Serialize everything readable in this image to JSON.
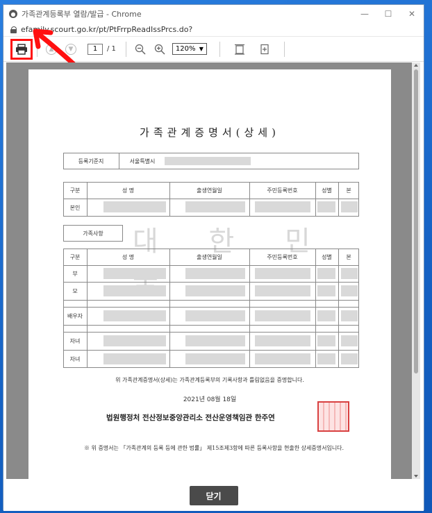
{
  "window": {
    "title": "가족관계등록부 열람/발급 - Chrome",
    "url": "efamily.scourt.go.kr/pt/PtFrrpReadIssPrcs.do?",
    "minimize": "—",
    "maximize": "☐",
    "close": "✕"
  },
  "toolbar": {
    "page_current": "1",
    "page_total": "/ 1",
    "zoom": "120%"
  },
  "document": {
    "title": "가족관계증명서(상세)",
    "reg_label": "등록기준지",
    "reg_value": "서울특별시",
    "table1_headers": [
      "구분",
      "성   명",
      "출생연월일",
      "주민등록번호",
      "성별",
      "본"
    ],
    "table1_rows": [
      "본인"
    ],
    "family_label": "가족사항",
    "table2_headers": [
      "구분",
      "성   명",
      "출생연월일",
      "주민등록번호",
      "성별",
      "본"
    ],
    "table2_rows": [
      "부",
      "모",
      "배우자",
      "자녀",
      "자녀"
    ],
    "statement": "위 가족관계증명서(상세)는 가족관계등록부의 기록사항과 틀림없음을 증명합니다.",
    "date": "2021년 08월 18일",
    "issuer": "법원행정처 전산정보중앙관리소 전산운영책임관 한주연",
    "note": "※ 위 증명서는 「가족관계의 등록 등에 관한 법률」 제15조제3항에 따른 등록사항을 현출한 상세증명서입니다.",
    "watermark": "대 한 민 국"
  },
  "footer": {
    "close_label": "닫기"
  },
  "colors": {
    "highlight": "#ff1010",
    "desktop": "#1e6fd0",
    "viewer_bg": "#8a8a8a",
    "close_button": "#4a4a4a"
  }
}
